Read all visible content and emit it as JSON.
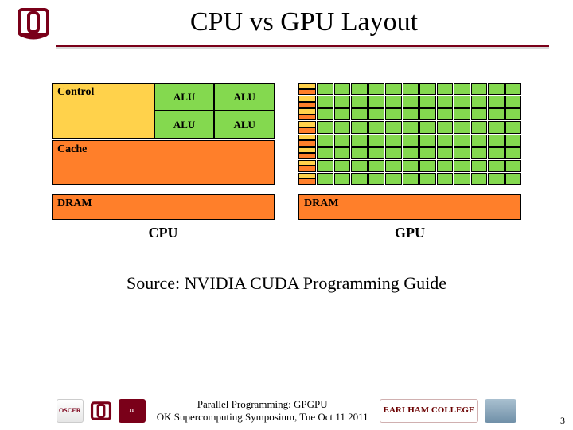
{
  "header": {
    "title": "CPU vs GPU Layout"
  },
  "cpu": {
    "control_label": "Control",
    "alu_label": "ALU",
    "cache_label": "Cache",
    "dram_label": "DRAM",
    "name": "CPU"
  },
  "gpu": {
    "dram_label": "DRAM",
    "name": "GPU",
    "rows": 8,
    "cores_per_row": 12
  },
  "source_line": "Source: NVIDIA CUDA Programming Guide",
  "footer": {
    "line1": "Parallel Programming: GPGPU",
    "line2": "OK Supercomputing Symposium, Tue Oct 11 2011",
    "logos_left": [
      "OSCER",
      "OU",
      "IT"
    ],
    "logos_right": [
      "EARLHAM COLLEGE",
      "photo"
    ]
  },
  "page_number": "3"
}
